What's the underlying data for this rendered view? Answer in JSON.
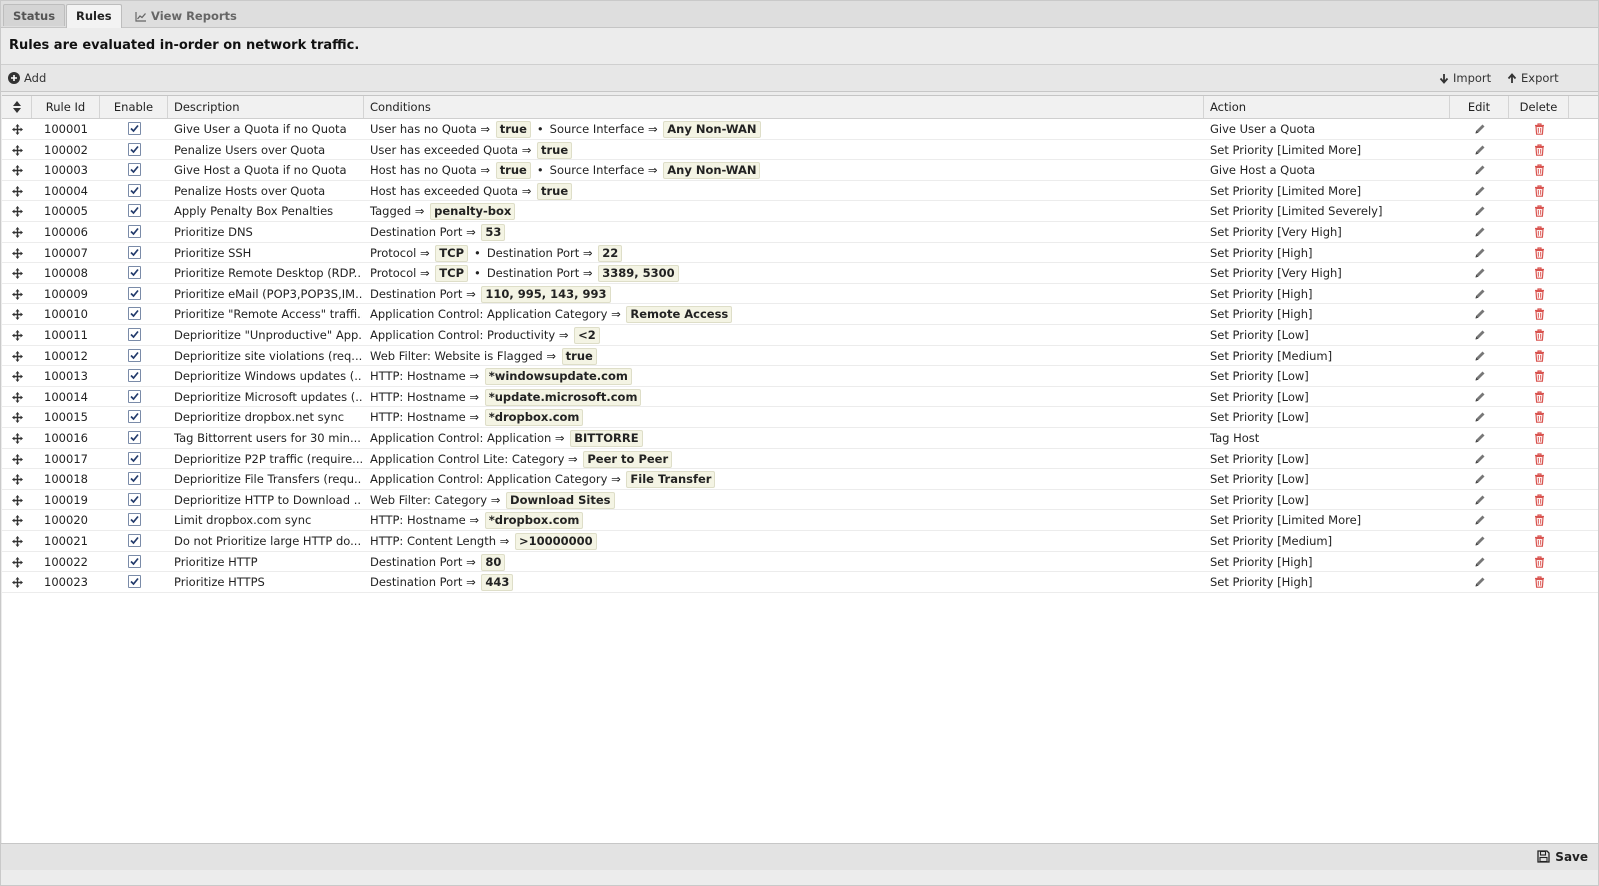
{
  "tabs": [
    {
      "label": "Status",
      "active": false
    },
    {
      "label": "Rules",
      "active": true
    },
    {
      "label": "View Reports",
      "active": false,
      "icon": "line-chart-icon"
    }
  ],
  "headline": "Rules are evaluated in-order on network traffic.",
  "toolbar": {
    "add_label": "Add",
    "import_label": "Import",
    "export_label": "Export"
  },
  "columns": {
    "reorder": "",
    "rule_id": "Rule Id",
    "enable": "Enable",
    "description": "Description",
    "conditions": "Conditions",
    "action": "Action",
    "edit": "Edit",
    "delete": "Delete"
  },
  "rules": [
    {
      "id": "100001",
      "enabled": true,
      "description": "Give User a Quota if no Quota",
      "conditions": [
        {
          "label": "User has no Quota",
          "value": "true"
        },
        {
          "label": "Source Interface",
          "value": "Any Non-WAN"
        }
      ],
      "action": "Give User a Quota"
    },
    {
      "id": "100002",
      "enabled": true,
      "description": "Penalize Users over Quota",
      "conditions": [
        {
          "label": "User has exceeded Quota",
          "value": "true"
        }
      ],
      "action": "Set Priority [Limited More]"
    },
    {
      "id": "100003",
      "enabled": true,
      "description": "Give Host a Quota if no Quota",
      "conditions": [
        {
          "label": "Host has no Quota",
          "value": "true"
        },
        {
          "label": "Source Interface",
          "value": "Any Non-WAN"
        }
      ],
      "action": "Give Host a Quota"
    },
    {
      "id": "100004",
      "enabled": true,
      "description": "Penalize Hosts over Quota",
      "conditions": [
        {
          "label": "Host has exceeded Quota",
          "value": "true"
        }
      ],
      "action": "Set Priority [Limited More]"
    },
    {
      "id": "100005",
      "enabled": true,
      "description": "Apply Penalty Box Penalties",
      "conditions": [
        {
          "label": "Tagged",
          "value": "penalty-box"
        }
      ],
      "action": "Set Priority [Limited Severely]"
    },
    {
      "id": "100006",
      "enabled": true,
      "description": "Prioritize DNS",
      "conditions": [
        {
          "label": "Destination Port",
          "value": "53"
        }
      ],
      "action": "Set Priority [Very High]"
    },
    {
      "id": "100007",
      "enabled": true,
      "description": "Prioritize SSH",
      "conditions": [
        {
          "label": "Protocol",
          "value": "TCP"
        },
        {
          "label": "Destination Port",
          "value": "22"
        }
      ],
      "action": "Set Priority [High]"
    },
    {
      "id": "100008",
      "enabled": true,
      "description": "Prioritize Remote Desktop (RDP...",
      "conditions": [
        {
          "label": "Protocol",
          "value": "TCP"
        },
        {
          "label": "Destination Port",
          "value": "3389, 5300"
        }
      ],
      "action": "Set Priority [Very High]"
    },
    {
      "id": "100009",
      "enabled": true,
      "description": "Prioritize eMail (POP3,POP3S,IM...",
      "conditions": [
        {
          "label": "Destination Port",
          "value": "110, 995, 143, 993"
        }
      ],
      "action": "Set Priority [High]"
    },
    {
      "id": "100010",
      "enabled": true,
      "description": "Prioritize \"Remote Access\" traffi...",
      "conditions": [
        {
          "label": "Application Control: Application Category",
          "value": "Remote Access"
        }
      ],
      "action": "Set Priority [High]"
    },
    {
      "id": "100011",
      "enabled": true,
      "description": "Deprioritize \"Unproductive\" App...",
      "conditions": [
        {
          "label": "Application Control: Productivity",
          "value": "<2"
        }
      ],
      "action": "Set Priority [Low]"
    },
    {
      "id": "100012",
      "enabled": true,
      "description": "Deprioritize site violations (req...",
      "conditions": [
        {
          "label": "Web Filter: Website is Flagged",
          "value": "true"
        }
      ],
      "action": "Set Priority [Medium]"
    },
    {
      "id": "100013",
      "enabled": true,
      "description": "Deprioritize Windows updates (...",
      "conditions": [
        {
          "label": "HTTP: Hostname",
          "value": "*windowsupdate.com"
        }
      ],
      "action": "Set Priority [Low]"
    },
    {
      "id": "100014",
      "enabled": true,
      "description": "Deprioritize Microsoft updates (...",
      "conditions": [
        {
          "label": "HTTP: Hostname",
          "value": "*update.microsoft.com"
        }
      ],
      "action": "Set Priority [Low]"
    },
    {
      "id": "100015",
      "enabled": true,
      "description": "Deprioritize dropbox.net sync",
      "conditions": [
        {
          "label": "HTTP: Hostname",
          "value": "*dropbox.com"
        }
      ],
      "action": "Set Priority [Low]"
    },
    {
      "id": "100016",
      "enabled": true,
      "description": "Tag Bittorrent users for 30 min...",
      "conditions": [
        {
          "label": "Application Control: Application",
          "value": "BITTORRE"
        }
      ],
      "action": "Tag Host"
    },
    {
      "id": "100017",
      "enabled": true,
      "description": "Deprioritize P2P traffic (require...",
      "conditions": [
        {
          "label": "Application Control Lite: Category",
          "value": "Peer to Peer"
        }
      ],
      "action": "Set Priority [Low]"
    },
    {
      "id": "100018",
      "enabled": true,
      "description": "Deprioritize File Transfers (requ...",
      "conditions": [
        {
          "label": "Application Control: Application Category",
          "value": "File Transfer"
        }
      ],
      "action": "Set Priority [Low]"
    },
    {
      "id": "100019",
      "enabled": true,
      "description": "Deprioritize HTTP to Download ...",
      "conditions": [
        {
          "label": "Web Filter: Category",
          "value": "Download Sites"
        }
      ],
      "action": "Set Priority [Low]"
    },
    {
      "id": "100020",
      "enabled": true,
      "description": "Limit dropbox.com sync",
      "conditions": [
        {
          "label": "HTTP: Hostname",
          "value": "*dropbox.com"
        }
      ],
      "action": "Set Priority [Limited More]"
    },
    {
      "id": "100021",
      "enabled": true,
      "description": "Do not Prioritize large HTTP do...",
      "conditions": [
        {
          "label": "HTTP: Content Length",
          "value": ">10000000"
        }
      ],
      "action": "Set Priority [Medium]"
    },
    {
      "id": "100022",
      "enabled": true,
      "description": "Prioritize HTTP",
      "conditions": [
        {
          "label": "Destination Port",
          "value": "80"
        }
      ],
      "action": "Set Priority [High]"
    },
    {
      "id": "100023",
      "enabled": true,
      "description": "Prioritize HTTPS",
      "conditions": [
        {
          "label": "Destination Port",
          "value": "443"
        }
      ],
      "action": "Set Priority [High]"
    }
  ],
  "footer": {
    "save_label": "Save"
  },
  "colors": {
    "accent": "#d9534f",
    "value_bg": "#f4f4e4",
    "checkbox_border": "#7a8ba8"
  }
}
